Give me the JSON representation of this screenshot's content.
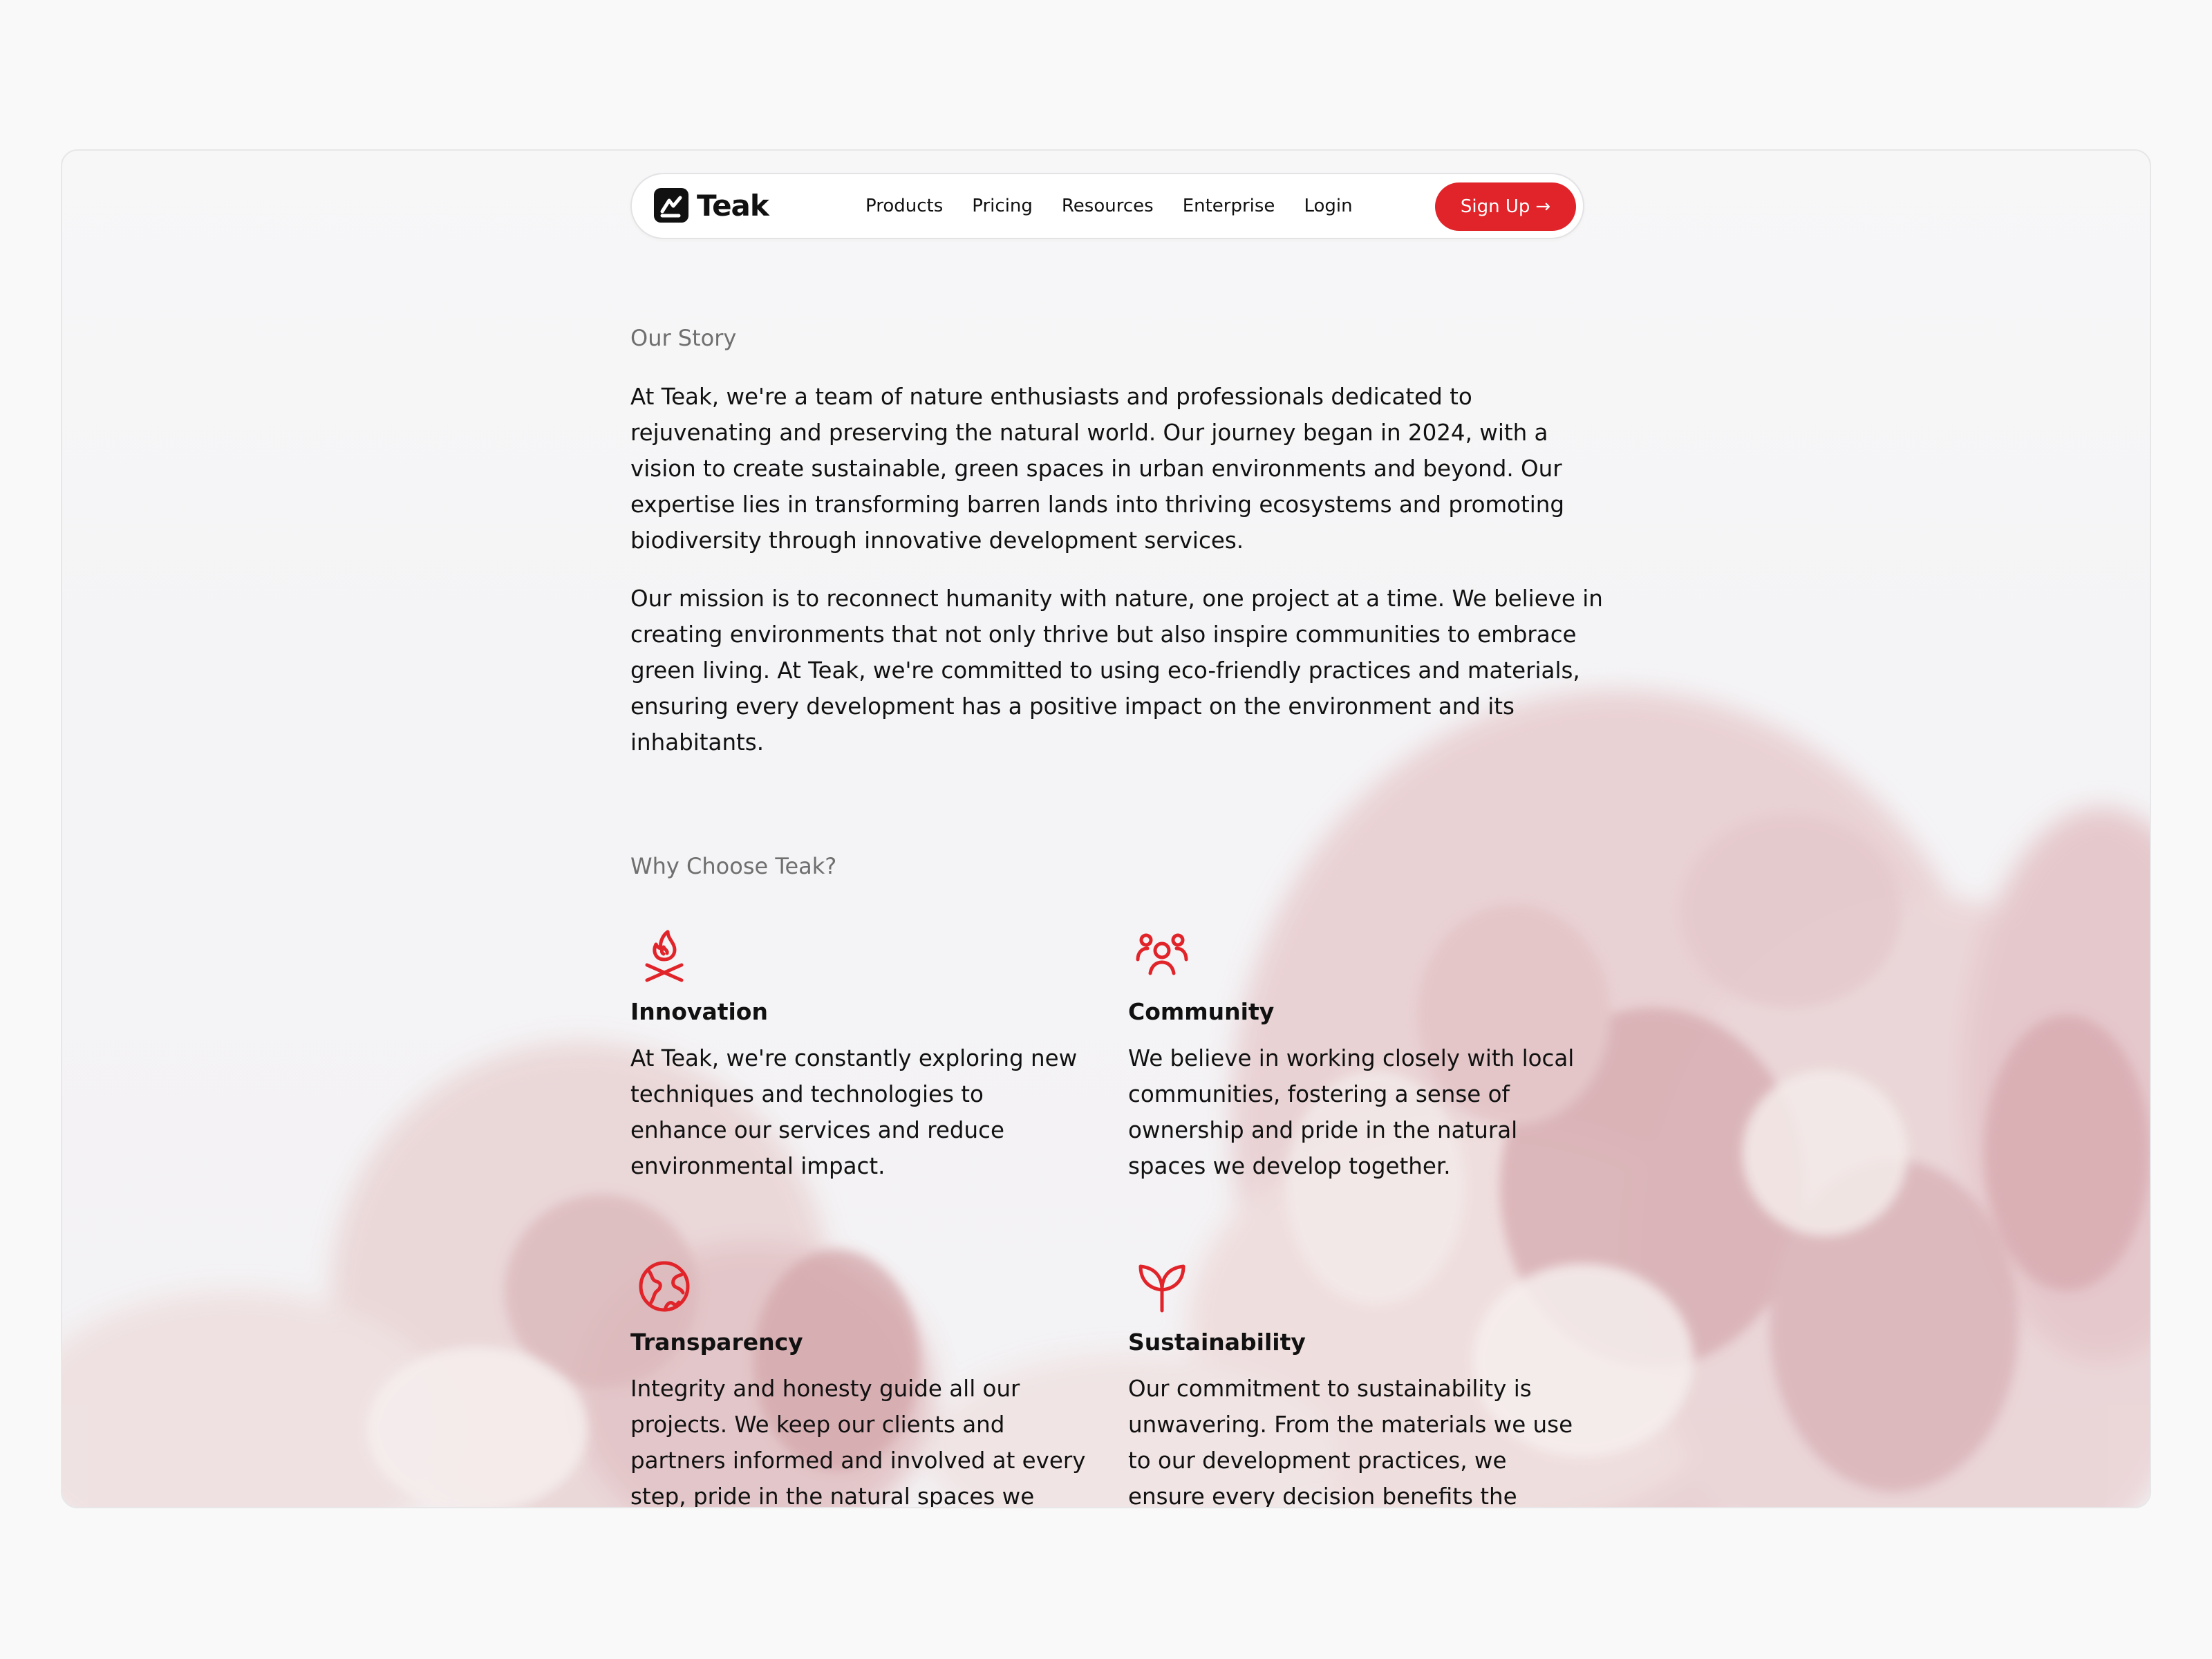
{
  "brand": {
    "name": "Teak"
  },
  "nav": {
    "links": [
      "Products",
      "Pricing",
      "Resources",
      "Enterprise",
      "Login"
    ],
    "signup_label": "Sign Up",
    "signup_arrow": "→"
  },
  "story": {
    "heading": "Our Story",
    "paragraphs": [
      "At Teak, we're a team of nature enthusiasts and professionals dedicated to rejuvenating and preserving the natural world. Our journey began in 2024, with a vision to create sustainable, green spaces in urban environments and beyond. Our expertise lies in transforming barren lands into thriving ecosystems and promoting biodiversity through innovative development services.",
      "Our mission is to reconnect humanity with nature, one project at a time. We believe in creating environments that not only thrive but also inspire communities to embrace green living. At Teak, we're committed to using eco-friendly practices and materials, ensuring every development has a positive impact on the environment and its inhabitants."
    ]
  },
  "why": {
    "heading": "Why Choose Teak?",
    "features": [
      {
        "icon": "campfire-icon",
        "title": "Innovation",
        "text": "At Teak, we're constantly exploring new techniques and technologies to enhance our services and reduce environmental impact."
      },
      {
        "icon": "community-icon",
        "title": "Community",
        "text": "We believe in working closely with local communities, fostering a sense of ownership and pride in the natural spaces we develop together."
      },
      {
        "icon": "globe-icon",
        "title": "Transparency",
        "text": "Integrity and honesty guide all our projects. We keep our clients and partners informed and involved at every step, pride in the natural spaces we develop together."
      },
      {
        "icon": "sprout-icon",
        "title": "Sustainability",
        "text": "Our commitment to sustainability is unwavering. From the materials we use to our development practices, we ensure every decision benefits the planet."
      }
    ]
  },
  "colors": {
    "accent": "#e0242a",
    "text": "#111111",
    "muted": "#6f6f6f",
    "background": "#f9f9f9"
  }
}
